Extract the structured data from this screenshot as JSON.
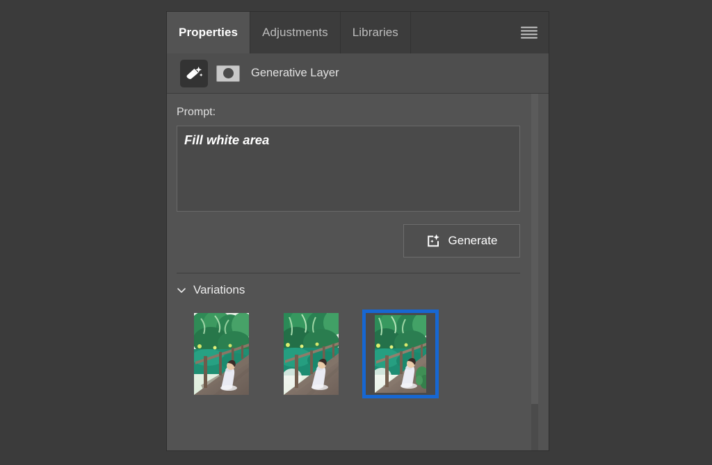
{
  "panel": {
    "tabs": [
      {
        "label": "Properties",
        "active": true
      },
      {
        "label": "Adjustments",
        "active": false
      },
      {
        "label": "Libraries",
        "active": false
      }
    ],
    "menu_icon": "hamburger-menu-icon",
    "layer": {
      "icon": "generative-fill-layer-icon",
      "mask_icon": "layer-mask-thumbnail-icon",
      "title": "Generative Layer"
    },
    "prompt": {
      "label": "Prompt:",
      "value": "Fill white area",
      "placeholder": "Describe the image you want to generate"
    },
    "generate": {
      "label": "Generate",
      "icon": "generative-fill-icon"
    },
    "variations": {
      "label": "Variations",
      "chevron_icon": "chevron-down-icon",
      "selected_index": 2,
      "items": [
        {
          "name": "variation-1",
          "alt": "Woman in white dress sitting on a wooden bridge with palm trees",
          "selected": false
        },
        {
          "name": "variation-2",
          "alt": "Woman in white dress sitting on a wooden bridge with green trees",
          "selected": false
        },
        {
          "name": "variation-3",
          "alt": "Woman in white dress sitting on a wooden bridge, wider foliage",
          "selected": true
        }
      ]
    },
    "colors": {
      "panel_bg": "#535353",
      "tabbar_bg": "#3c3c3c",
      "active_tab_bg": "#535353",
      "layer_header_bg": "#4e4e4e",
      "selection_blue": "#1767d2",
      "canvas_bg": "#3b3b3b",
      "input_bg": "#4a4a4a"
    }
  }
}
